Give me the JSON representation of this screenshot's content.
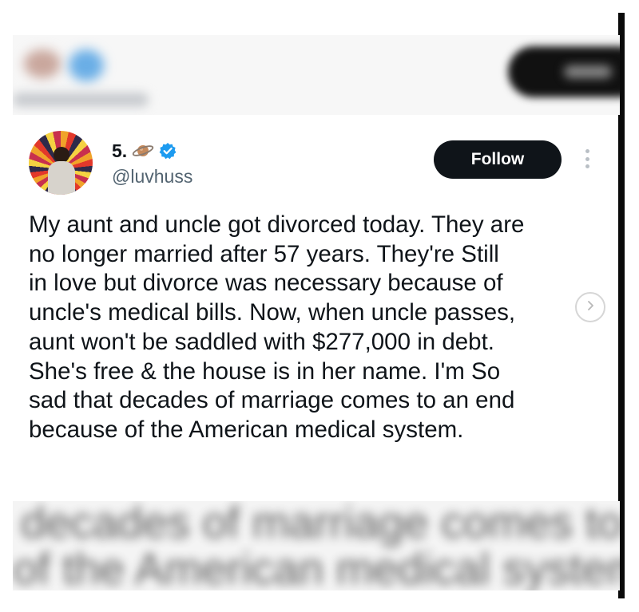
{
  "tweet": {
    "display_name": "5.",
    "handle": "@luvhuss",
    "follow_label": "Follow",
    "text_lines": [
      "My aunt and uncle got divorced today. They are",
      "no longer married after 57 years. They're Still",
      "in love but divorce was necessary because of",
      "uncle's medical bills. Now, when uncle passes,",
      "aunt won't be saddled with $277,000 in debt.",
      "She's free & the house is in her name. I'm  So",
      "sad that decades of marriage comes to an end",
      "because of the American medical system."
    ]
  },
  "background_blur": {
    "line_1": "decades of marriage comes to a",
    "line_2": "of the American medical system"
  },
  "icons": {
    "name_emoji": "planet-icon",
    "verified": "verified-badge-icon",
    "more": "more-options-icon",
    "next": "chevron-right-icon"
  },
  "colors": {
    "text_primary": "#0f1419",
    "text_secondary": "#536471",
    "verified_blue": "#1d9bf0",
    "follow_bg": "#0f1419",
    "follow_text": "#ffffff"
  }
}
